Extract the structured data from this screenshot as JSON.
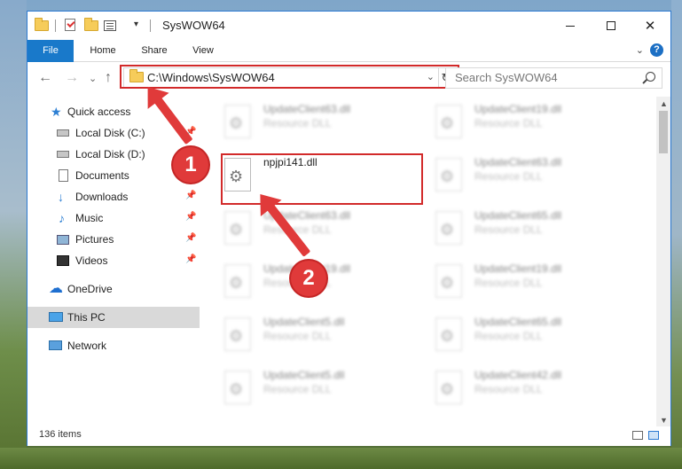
{
  "window": {
    "title": "SysWOW64",
    "qa_dropdown": "▾",
    "btn_minimize": "—",
    "btn_maximize": "☐",
    "btn_close": "✕"
  },
  "ribbon": {
    "tabs": [
      "File",
      "Home",
      "Share",
      "View"
    ],
    "expand_glyph": "⌄",
    "help_glyph": "?"
  },
  "nav": {
    "back": "←",
    "forward": "→",
    "recent": "⌄",
    "up": "↑",
    "address": "C:\\Windows\\SysWOW64",
    "address_dropdown": "⌄",
    "refresh": "↻",
    "search_placeholder": "Search SysWOW64"
  },
  "sidebar": {
    "pin_glyph": "📌",
    "items": [
      {
        "label": "Quick access",
        "icon": "star-icon"
      },
      {
        "label": "Local Disk (C:)",
        "icon": "disk-icon",
        "pinned": true
      },
      {
        "label": "Local Disk (D:)",
        "icon": "disk-icon",
        "pinned": true
      },
      {
        "label": "Documents",
        "icon": "documents-icon",
        "pinned": true
      },
      {
        "label": "Downloads",
        "icon": "downloads-icon",
        "pinned": true
      },
      {
        "label": "Music",
        "icon": "music-icon",
        "pinned": true
      },
      {
        "label": "Pictures",
        "icon": "pictures-icon",
        "pinned": true
      },
      {
        "label": "Videos",
        "icon": "videos-icon",
        "pinned": true
      },
      {
        "label": "OneDrive",
        "icon": "onedrive-icon"
      },
      {
        "label": "This PC",
        "icon": "this-pc-icon",
        "selected": true
      },
      {
        "label": "Network",
        "icon": "network-icon"
      }
    ]
  },
  "files": {
    "left": [
      {
        "name": "UpdateClient63.dll",
        "type": "Resource DLL"
      },
      {
        "name": "npjpi141.dll",
        "type": ""
      },
      {
        "name": "UpdateClient63.dll",
        "type": "Resource DLL"
      },
      {
        "name": "UpdateClient19.dll",
        "type": "Resource DLL"
      },
      {
        "name": "UpdateClient5.dll",
        "type": "Resource DLL"
      },
      {
        "name": "UpdateClient5.dll",
        "type": "Resource DLL"
      }
    ],
    "right": [
      {
        "name": "UpdateClient19.dll",
        "type": "Resource DLL"
      },
      {
        "name": "UpdateClient63.dll",
        "type": "Resource DLL"
      },
      {
        "name": "UpdateClient65.dll",
        "type": "Resource DLL"
      },
      {
        "name": "UpdateClient19.dll",
        "type": "Resource DLL"
      },
      {
        "name": "UpdateClient65.dll",
        "type": "Resource DLL"
      },
      {
        "name": "UpdateClient42.dll",
        "type": "Resource DLL"
      }
    ]
  },
  "status": {
    "items_count": "136 items"
  },
  "annotations": {
    "step1": "1",
    "step2": "2",
    "color": "#e03a3a"
  },
  "scrollbar": {
    "up": "▲",
    "down": "▼"
  }
}
